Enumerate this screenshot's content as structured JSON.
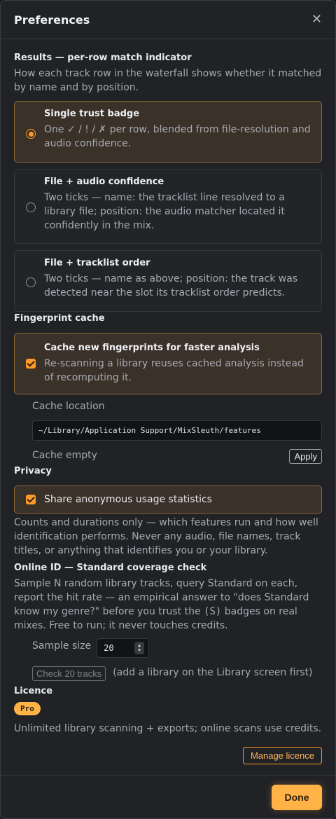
{
  "dialog": {
    "title": "Preferences"
  },
  "results": {
    "title": "Results — per-row match indicator",
    "desc": "How each track row in the waterfall shows whether it matched by name and by position.",
    "options": [
      {
        "title": "Single trust badge",
        "desc": "One ✓ / ! / ✗ per row, blended from file-resolution and audio confidence.",
        "selected": true
      },
      {
        "title": "File + audio confidence",
        "desc": "Two ticks — name: the tracklist line resolved to a library file; position: the audio matcher located it confidently in the mix.",
        "selected": false
      },
      {
        "title": "File + tracklist order",
        "desc": "Two ticks — name as above; position: the track was detected near the slot its tracklist order predicts.",
        "selected": false
      }
    ]
  },
  "cache": {
    "title": "Fingerprint cache",
    "checkbox_title": "Cache new fingerprints for faster analysis",
    "checkbox_desc": "Re-scanning a library reuses cached analysis instead of recomputing it.",
    "location_label": "Cache location",
    "location_value": "~/Library/Application Support/MixSleuth/features",
    "status": "Cache empty",
    "apply_label": "Apply"
  },
  "privacy": {
    "title": "Privacy",
    "checkbox_label": "Share anonymous usage statistics",
    "desc": "Counts and durations only — which features run and how well identification performs. Never any audio, file names, track titles, or anything that identifies you or your library."
  },
  "online": {
    "title": "Online ID — Standard coverage check",
    "desc_before": "Sample N random library tracks, query Standard on each, report the hit rate — an empirical answer to \"does Standard know my genre?\" before you trust the ",
    "desc_badge": "(S)",
    "desc_after": " badges on real mixes. Free to run; it never touches credits.",
    "sample_label": "Sample size",
    "sample_value": "20",
    "check_button": "Check 20 tracks",
    "hint": "(add a library on the Library screen first)"
  },
  "licence": {
    "title": "Licence",
    "badge": "Pro",
    "desc": "Unlimited library scanning + exports; online scans use credits.",
    "manage_label": "Manage licence"
  },
  "footer": {
    "done_label": "Done"
  },
  "icons": {
    "close": "close-icon",
    "spin": "spinner-arrows-icon",
    "check": "checkmark-icon"
  },
  "colors": {
    "accent": "#ff9a2e",
    "accent_light": "#ffb347",
    "background": "#202226"
  }
}
